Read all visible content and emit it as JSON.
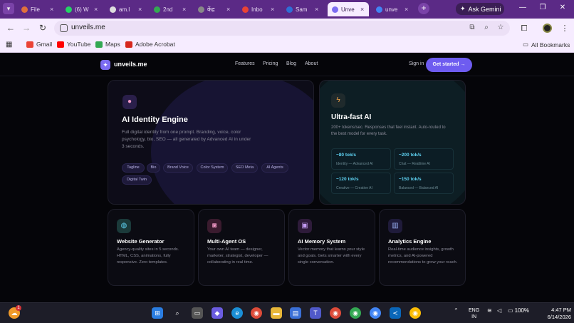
{
  "browser": {
    "tabs": [
      {
        "label": "File",
        "active": false,
        "favicon_color": "#e0703c"
      },
      {
        "label": "(6) W",
        "active": false,
        "favicon_color": "#25d366"
      },
      {
        "label": "am.l",
        "active": false,
        "favicon_color": "#dddddd"
      },
      {
        "label": "2nd",
        "active": false,
        "favicon_color": "#34a853"
      },
      {
        "label": "केंद्र",
        "active": false,
        "favicon_color": "#888888"
      },
      {
        "label": "Inbo",
        "active": false,
        "favicon_color": "#ea4335"
      },
      {
        "label": "Sam",
        "active": false,
        "favicon_color": "#2f6fd6"
      },
      {
        "label": "Unve",
        "active": true,
        "favicon_color": "#7c6cf2"
      },
      {
        "label": "unve",
        "active": false,
        "favicon_color": "#4285f4"
      }
    ],
    "tab_close_glyph": "×",
    "new_tab_glyph": "+",
    "ask_gemini": "Ask Gemini",
    "address": "unveils.me",
    "bookmarks": [
      {
        "label": "Gmail",
        "color": "#ea4335"
      },
      {
        "label": "YouTube",
        "color": "#ff0000"
      },
      {
        "label": "Maps",
        "color": "#34a853"
      },
      {
        "label": "Adobe Acrobat",
        "color": "#d6281e"
      }
    ],
    "all_bookmarks": "All Bookmarks"
  },
  "site": {
    "logo_text": "unveils.me",
    "nav_links": [
      "Features",
      "Pricing",
      "Blog",
      "About"
    ],
    "sign_in": "Sign in",
    "get_started": "Get started →",
    "identity": {
      "title": "AI Identity Engine",
      "desc": "Full digital identity from one prompt. Branding, voice, color psychology, bio, SEO — all generated by Advanced AI in under 3 seconds.",
      "tags": [
        "Tagline",
        "Bio",
        "Brand Voice",
        "Color System",
        "SEO Meta",
        "AI Agents",
        "Digital Twin"
      ]
    },
    "fast": {
      "title": "Ultra-fast AI",
      "desc": "200+ tokens/sec. Responses that feel instant. Auto-routed to the best model for every task.",
      "metrics": [
        {
          "value": "~80 tok/s",
          "label": "Identity — Advanced AI"
        },
        {
          "value": "~200 tok/s",
          "label": "Chat — Realtime AI"
        },
        {
          "value": "~120 tok/s",
          "label": "Creative — Creative AI"
        },
        {
          "value": "~150 tok/s",
          "label": "Balanced — Balanced AI"
        }
      ]
    },
    "features": [
      {
        "title": "Website Generator",
        "desc": "Agency-quality sites in 5 seconds. HTML, CSS, animations, fully responsive. Zero templates.",
        "icon": "globe-icon",
        "glyph": "◍",
        "color": "#1b3a3a"
      },
      {
        "title": "Multi-Agent OS",
        "desc": "Your own AI team — designer, marketer, strategist, developer — collaborating in real time.",
        "icon": "robot-icon",
        "glyph": "◙",
        "color": "#3a1b2e"
      },
      {
        "title": "AI Memory System",
        "desc": "Vector memory that learns your style and goals. Gets smarter with every single conversation.",
        "icon": "floppy-disk-icon",
        "glyph": "▣",
        "color": "#2e1b3a"
      },
      {
        "title": "Analytics Engine",
        "desc": "Real-time audience insights, growth metrics, and AI-powered recommendations to grow your reach.",
        "icon": "bar-chart-icon",
        "glyph": "▥",
        "color": "#1f1b3a"
      }
    ]
  },
  "taskbar": {
    "weather_badge": "1",
    "language": "ENG",
    "region": "IN",
    "battery": "100%",
    "time": "4:47 PM",
    "date": "6/14/2026"
  }
}
